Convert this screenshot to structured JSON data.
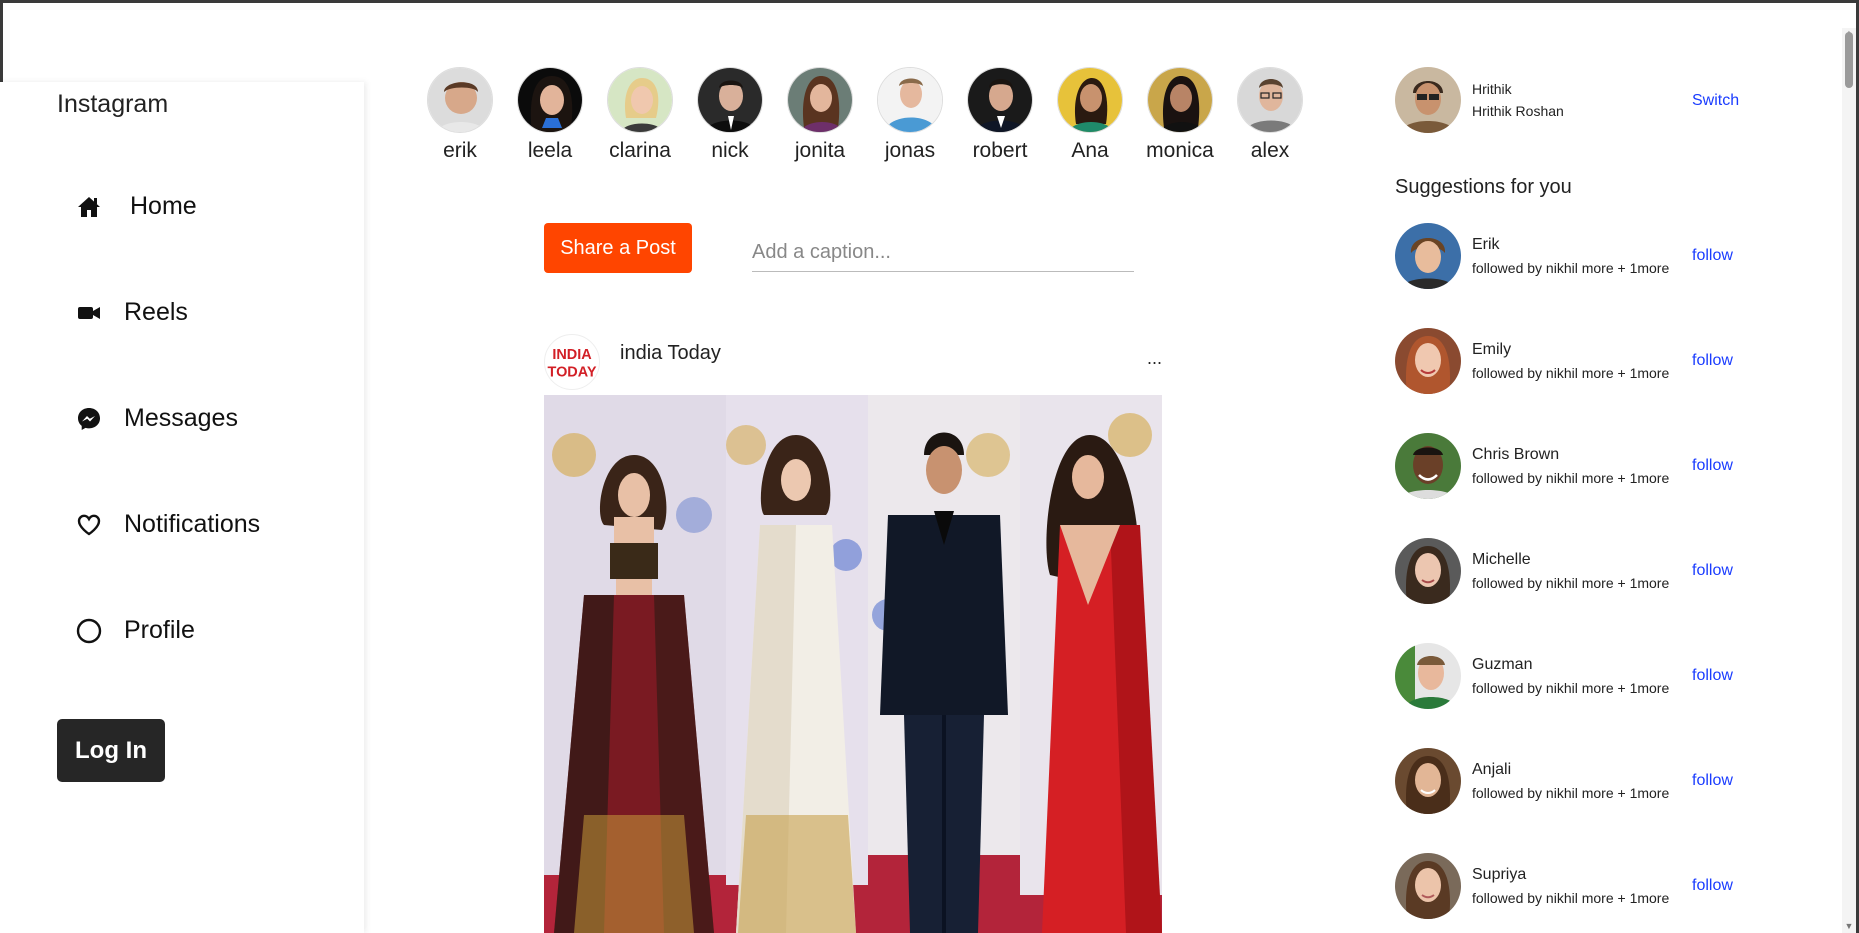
{
  "sidebar": {
    "brand": "Instagram",
    "items": [
      {
        "label": "Home",
        "icon": "home-icon"
      },
      {
        "label": "Reels",
        "icon": "video-camera-icon"
      },
      {
        "label": "Messages",
        "icon": "messenger-icon"
      },
      {
        "label": "Notifications",
        "icon": "heart-icon"
      },
      {
        "label": "Profile",
        "icon": "circle-icon"
      }
    ],
    "login_label": "Log In"
  },
  "stories": [
    {
      "name": "erik"
    },
    {
      "name": "leela"
    },
    {
      "name": "clarina"
    },
    {
      "name": "nick"
    },
    {
      "name": "jonita"
    },
    {
      "name": "jonas"
    },
    {
      "name": "robert"
    },
    {
      "name": "Ana"
    },
    {
      "name": "monica"
    },
    {
      "name": "alex"
    }
  ],
  "composer": {
    "share_label": "Share a Post",
    "caption_placeholder": "Add a caption...",
    "caption_value": ""
  },
  "post": {
    "author": "india Today",
    "more": "...",
    "logo_text_line1": "INDIA",
    "logo_text_line2": "TODAY"
  },
  "right": {
    "me": {
      "username": "Hrithik",
      "full_name": "Hrithik Roshan",
      "switch_label": "Switch"
    },
    "suggestions_title": "Suggestions for you",
    "suggestions": [
      {
        "name": "Erik",
        "meta": "followed by nikhil more + 1more",
        "follow": "follow"
      },
      {
        "name": "Emily",
        "meta": "followed by nikhil more + 1more",
        "follow": "follow"
      },
      {
        "name": "Chris Brown",
        "meta": "followed by nikhil more + 1more",
        "follow": "follow"
      },
      {
        "name": "Michelle",
        "meta": "followed by nikhil more + 1more",
        "follow": "follow"
      },
      {
        "name": "Guzman",
        "meta": "followed by nikhil more + 1more",
        "follow": "follow"
      },
      {
        "name": "Anjali",
        "meta": "followed by nikhil more + 1more",
        "follow": "follow"
      },
      {
        "name": "Supriya",
        "meta": "followed by nikhil more + 1more",
        "follow": "follow"
      }
    ]
  },
  "colors": {
    "accent_share": "#ff4500",
    "link_blue": "#1a3cff",
    "login_bg": "#262626"
  }
}
